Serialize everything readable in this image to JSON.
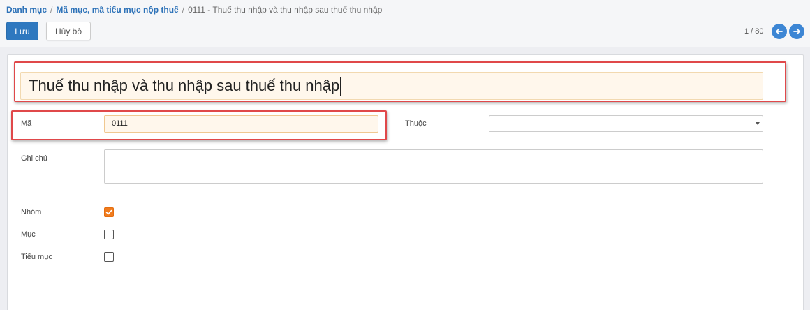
{
  "breadcrumb": {
    "items": [
      "Danh mục",
      "Mã mục, mã tiểu mục nộp thuế"
    ],
    "current": "0111 - Thuế thu nhập và thu nhập sau thuế thu nhập",
    "separator": "/"
  },
  "toolbar": {
    "save_label": "Lưu",
    "cancel_label": "Hủy bỏ"
  },
  "pager": {
    "text": "1 / 80",
    "prev_icon": "arrow-left-icon",
    "next_icon": "arrow-right-icon"
  },
  "form": {
    "title_value": "Thuế thu nhập và thu nhập sau thuế thu nhập",
    "code_label": "Mã",
    "code_value": "0111",
    "parent_label": "Thuộc",
    "parent_value": "",
    "note_label": "Ghi chú",
    "note_value": "",
    "group_label": "Nhóm",
    "group_checked": true,
    "item_label": "Mục",
    "item_checked": false,
    "subitem_label": "Tiểu mục",
    "subitem_checked": false
  },
  "colors": {
    "primary": "#2e78bf",
    "checkbox_accent": "#f07c1e",
    "highlight_border": "#e0484a",
    "input_focus_bg": "#fff7ec"
  }
}
